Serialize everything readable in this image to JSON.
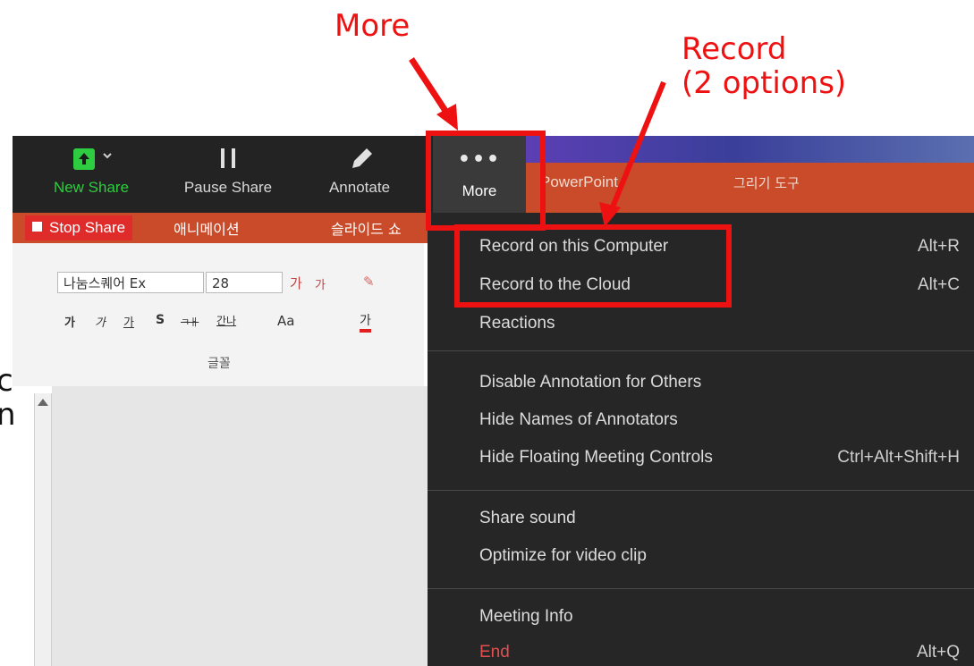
{
  "annotations": {
    "more_label": "More",
    "record_label_line1": "Record",
    "record_label_line2": "(2 options)"
  },
  "toolbar": {
    "new_share_label": "New Share",
    "pause_share_label": "Pause Share",
    "annotate_label": "Annotate",
    "more_label": "More",
    "stop_share_label": "Stop Share"
  },
  "ppt": {
    "title_fragment": "PowerPoint",
    "drawing_tools": "그리기 도구",
    "ribbon_tab_animations": "애니메이션",
    "ribbon_tab_slideshow": "슬라이드 쇼",
    "font_name": "나눔스퀘어 Ex",
    "font_size": "28",
    "font_group_label": "글꼴",
    "format_buttons": [
      "가",
      "가",
      "가",
      "S",
      "ㅋㅐ",
      "간나",
      "Aa",
      "가"
    ]
  },
  "menu": {
    "items": [
      {
        "label": "Record on this Computer",
        "shortcut": "Alt+R"
      },
      {
        "label": "Record to the Cloud",
        "shortcut": "Alt+C"
      },
      {
        "label": "Reactions",
        "shortcut": ""
      },
      {
        "label": "Disable Annotation for Others",
        "shortcut": ""
      },
      {
        "label": "Hide Names of Annotators",
        "shortcut": ""
      },
      {
        "label": "Hide Floating Meeting Controls",
        "shortcut": "Ctrl+Alt+Shift+H"
      },
      {
        "label": "Share sound",
        "shortcut": ""
      },
      {
        "label": "Optimize for video clip",
        "shortcut": ""
      },
      {
        "label": "Meeting Info",
        "shortcut": ""
      },
      {
        "label": "End",
        "shortcut": "Alt+Q"
      }
    ]
  },
  "background_text": {
    "line1": "c",
    "line2": "n"
  },
  "colors": {
    "callout_red": "#ee1111",
    "zoom_dark": "#232323",
    "menu_bg": "#262626",
    "ppt_orange": "#c94b2a",
    "new_share_green": "#2ecc40",
    "end_red": "#e05050"
  }
}
